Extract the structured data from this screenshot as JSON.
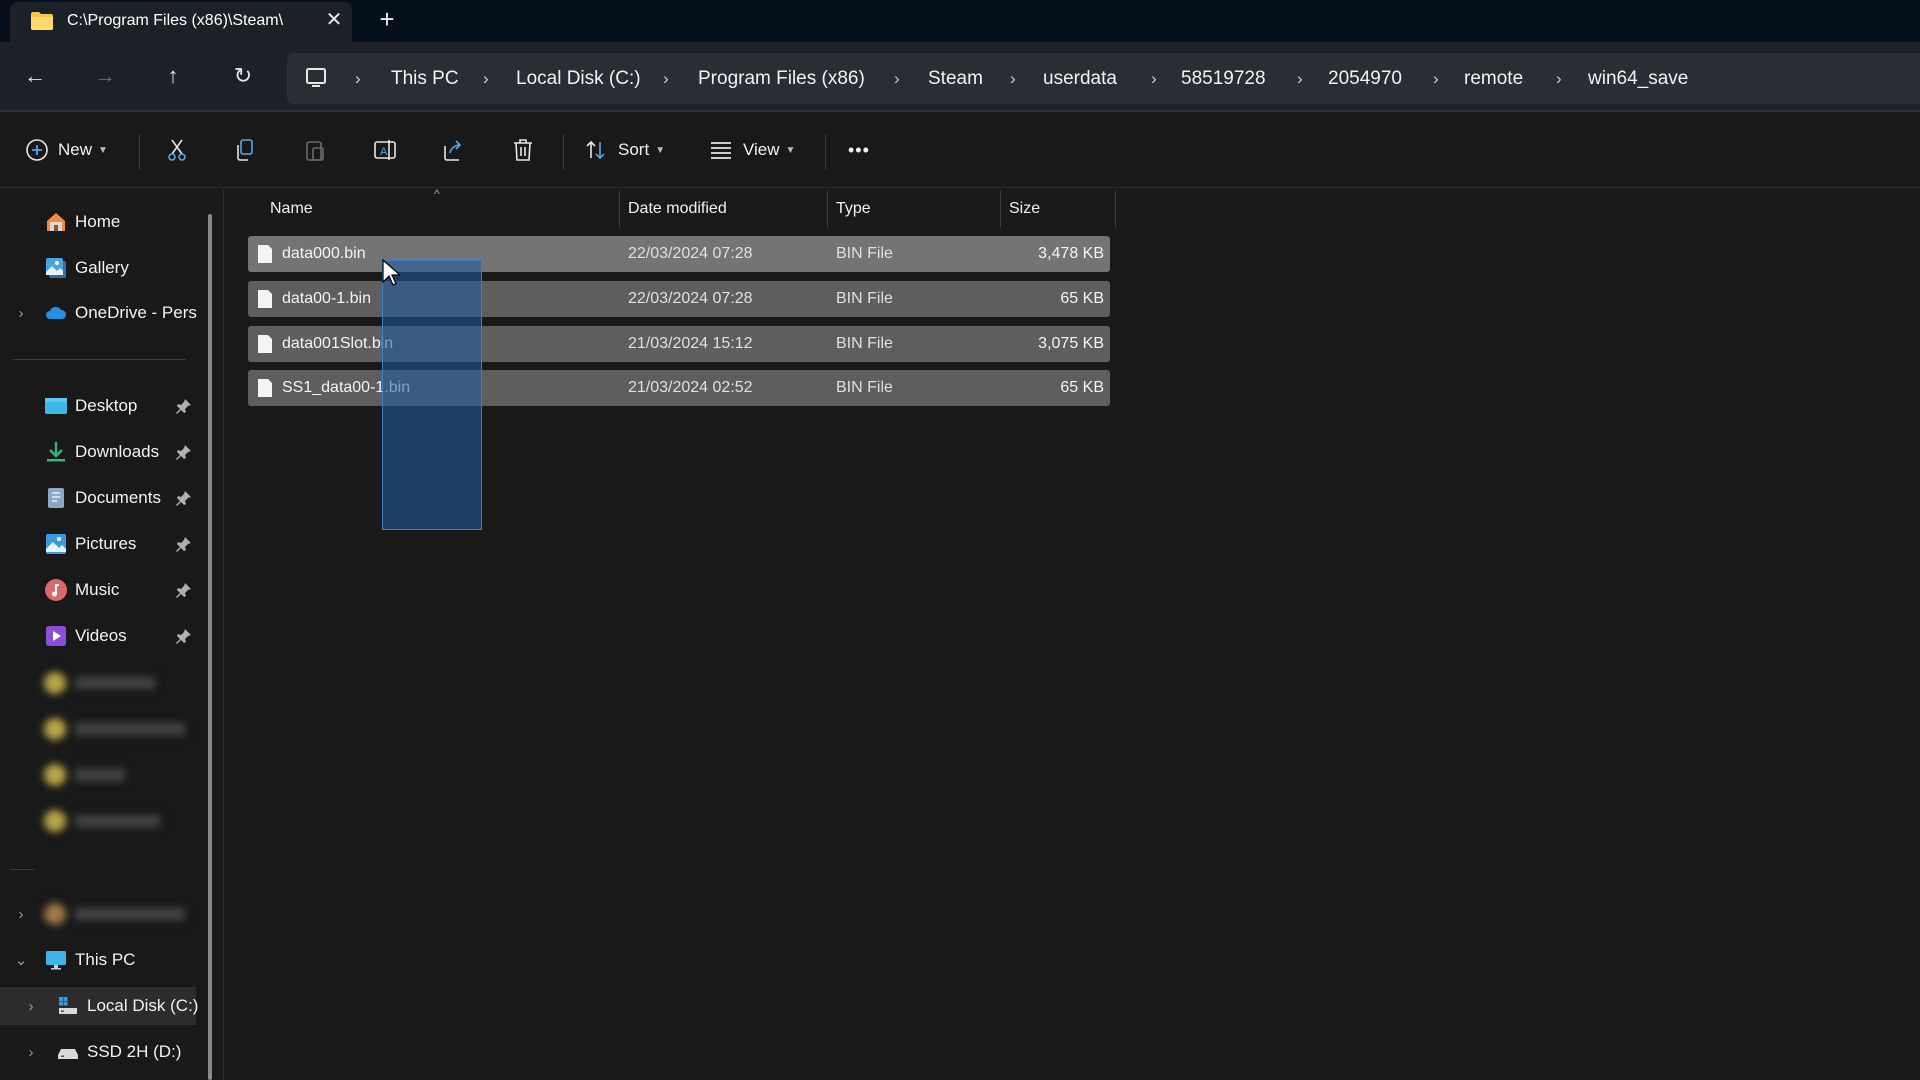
{
  "window": {
    "tab_title": "C:\\Program Files (x86)\\Steam\\",
    "tab_close_icon": "close-icon",
    "new_tab_icon": "plus-icon"
  },
  "nav": {
    "back": "back-arrow-icon",
    "forward": "forward-arrow-icon",
    "up": "up-arrow-icon",
    "refresh": "refresh-icon"
  },
  "breadcrumb": [
    "This PC",
    "Local Disk (C:)",
    "Program Files (x86)",
    "Steam",
    "userdata",
    "58519728",
    "2054970",
    "remote",
    "win64_save"
  ],
  "toolbar": {
    "new_label": "New",
    "sort_label": "Sort",
    "view_label": "View",
    "more_label": "•••",
    "icons": [
      "cut-icon",
      "copy-icon",
      "paste-icon",
      "rename-icon",
      "share-icon",
      "delete-icon"
    ]
  },
  "sidebar": {
    "top": [
      {
        "label": "Home",
        "icon": "home-icon"
      },
      {
        "label": "Gallery",
        "icon": "gallery-icon"
      },
      {
        "label": "OneDrive - Persi",
        "icon": "onedrive-icon",
        "expandable": true
      }
    ],
    "pinned": [
      {
        "label": "Desktop",
        "icon": "desktop-icon"
      },
      {
        "label": "Downloads",
        "icon": "downloads-icon"
      },
      {
        "label": "Documents",
        "icon": "documents-icon"
      },
      {
        "label": "Pictures",
        "icon": "pictures-icon"
      },
      {
        "label": "Music",
        "icon": "music-icon"
      },
      {
        "label": "Videos",
        "icon": "videos-icon"
      }
    ],
    "this_pc": {
      "label": "This PC",
      "icon": "this-pc-icon",
      "expanded": true
    },
    "drives": [
      {
        "label": "Local Disk (C:)",
        "icon": "local-disk-icon",
        "selected": true
      },
      {
        "label": "SSD 2H (D:)",
        "icon": "drive-icon",
        "selected": false
      }
    ]
  },
  "columns": {
    "name": "Name",
    "date": "Date modified",
    "type": "Type",
    "size": "Size"
  },
  "files": [
    {
      "name": "data000.bin",
      "date": "22/03/2024 07:28",
      "type": "BIN File",
      "size": "3,478 KB"
    },
    {
      "name": "data00-1.bin",
      "date": "22/03/2024 07:28",
      "type": "BIN File",
      "size": "65 KB"
    },
    {
      "name": "data001Slot.bin",
      "date": "21/03/2024 15:12",
      "type": "BIN File",
      "size": "3,075 KB"
    },
    {
      "name": "SS1_data00-1.bin",
      "date": "21/03/2024 02:52",
      "type": "BIN File",
      "size": "65 KB"
    }
  ],
  "colors": {
    "accent": "#3c82c8",
    "selection": "#1e5aa0",
    "folder": "#f2c94c"
  }
}
